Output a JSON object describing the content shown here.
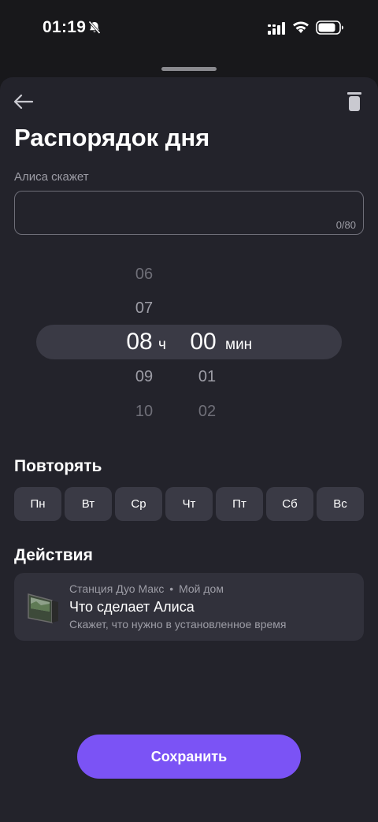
{
  "status_bar": {
    "time": "01:19"
  },
  "header": {
    "title": "Распорядок дня"
  },
  "alice_field": {
    "label": "Алиса скажет",
    "value": "",
    "counter": "0/80"
  },
  "time_picker": {
    "hours": [
      "06",
      "07",
      "08",
      "09",
      "10"
    ],
    "minutes": [
      "00",
      "01",
      "02"
    ],
    "selected_hour": "08",
    "selected_minute": "00",
    "hour_unit": "ч",
    "minute_unit": "мин"
  },
  "repeat": {
    "title": "Повторять",
    "days": [
      "Пн",
      "Вт",
      "Ср",
      "Чт",
      "Пт",
      "Сб",
      "Вс"
    ]
  },
  "actions": {
    "title": "Действия",
    "card": {
      "device": "Станция Дуо Макс",
      "separator": "•",
      "home": "Мой дом",
      "title": "Что сделает Алиса",
      "subtitle": "Скажет, что нужно в установленное время"
    }
  },
  "save_label": "Сохранить",
  "colors": {
    "accent": "#7b53f5",
    "background": "#23232b",
    "chip": "#3a3a45"
  }
}
